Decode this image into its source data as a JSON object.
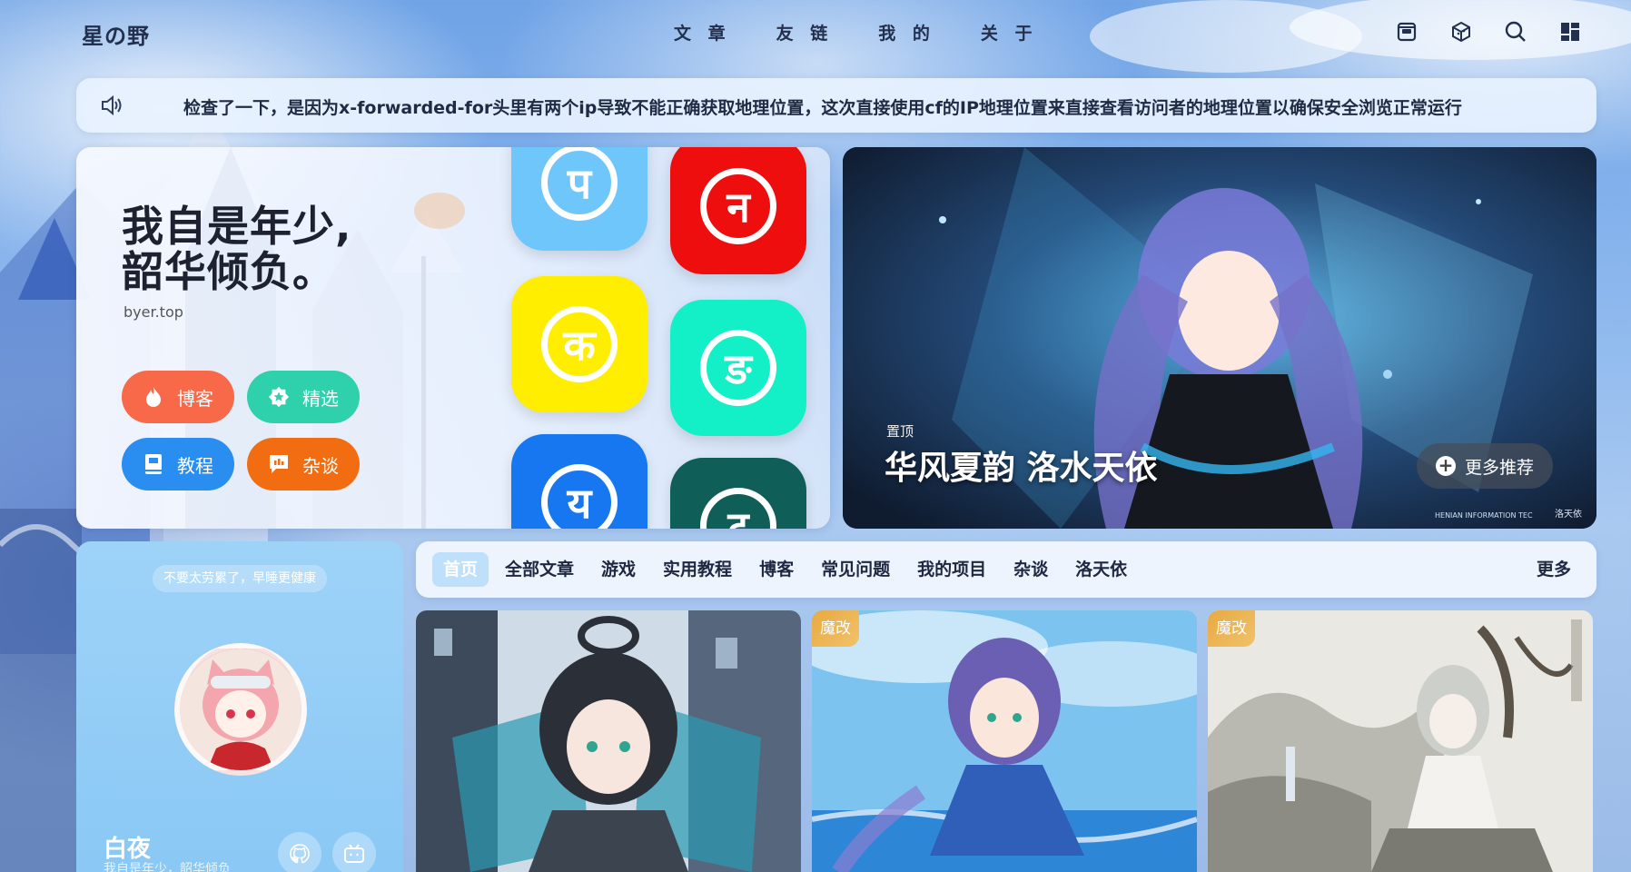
{
  "nav": {
    "logo": "星の野",
    "menu": [
      "文 章",
      "友 链",
      "我 的",
      "关 于"
    ],
    "icons": [
      "archive-icon",
      "cube-icon",
      "search-icon",
      "grid-icon"
    ]
  },
  "notice": {
    "icon": "speaker-icon",
    "text": "检查了一下，是因为x-forwarded-for头里有两个ip导致不能正确获取地理位置，这次直接使用cf的IP地理位置来直接查看访问者的地理位置以确保安全浏览正常运行"
  },
  "hero": {
    "title_line1": "我自是年少,",
    "title_line2": "韶华倾负。",
    "subtitle": "byer.top",
    "buttons": [
      {
        "label": "博客",
        "icon": "flame-icon",
        "color": "#f8694a"
      },
      {
        "label": "精选",
        "icon": "star-badge-icon",
        "color": "#2fd0ac"
      },
      {
        "label": "教程",
        "icon": "book-icon",
        "color": "#2a8df0"
      },
      {
        "label": "杂谈",
        "icon": "chat-icon",
        "color": "#f26d12"
      }
    ],
    "tiles": [
      {
        "glyph": "प",
        "color": "#6ec6fb"
      },
      {
        "glyph": "न",
        "color": "#ef0e0e"
      },
      {
        "glyph": "क",
        "color": "#ffee00"
      },
      {
        "glyph": "ङ",
        "color": "#13f0c8"
      },
      {
        "glyph": "य",
        "color": "#1677f0"
      },
      {
        "glyph": "ट",
        "color": "#0f5e57"
      }
    ]
  },
  "feature": {
    "tag": "置顶",
    "title": "华风夏韵 洛水天依",
    "more_label": "更多推荐",
    "watermark": "洛天依",
    "watermark2": "HENIAN INFORMATION TEC"
  },
  "profile": {
    "tip": "不要太劳累了，早睡更健康",
    "name": "白夜",
    "slogan": "我自是年少，韶华倾负",
    "social": [
      "github-icon",
      "bilibili-icon"
    ]
  },
  "categories": {
    "items": [
      "首页",
      "全部文章",
      "游戏",
      "实用教程",
      "博客",
      "常见问题",
      "我的项目",
      "杂谈",
      "洛天依"
    ],
    "active_index": 0,
    "more": "更多"
  },
  "cards": [
    {
      "badge": ""
    },
    {
      "badge": "魔改"
    },
    {
      "badge": "魔改"
    }
  ]
}
